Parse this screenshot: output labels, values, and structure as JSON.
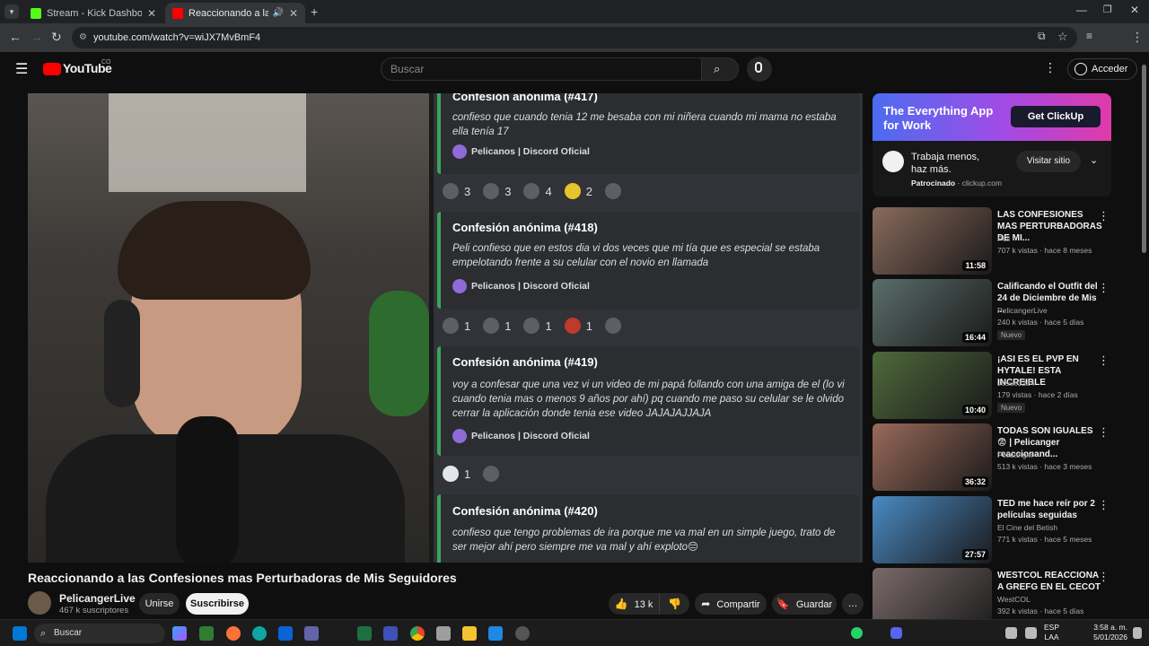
{
  "browser": {
    "tabs": [
      {
        "label": "Stream - Kick Dashboard",
        "color": "#53fc18"
      },
      {
        "label": "Reaccionando a las Confesi",
        "color": "#ff0000"
      }
    ],
    "url": "youtube.com/watch?v=wiJX7MvBmF4"
  },
  "youtube": {
    "logo": "YouTube",
    "country": "CO",
    "search_placeholder": "Buscar",
    "signin_label": "Acceder"
  },
  "video": {
    "chat": [
      {
        "title": "Confesión anónima (#417)",
        "body": "confieso que cuando tenia 12 me besaba con mi niñera cuando mi mama no estaba ella tenía 17",
        "source": "Pelicanos | Discord Oficial",
        "reactions": [
          "3",
          "3",
          "4",
          "2"
        ]
      },
      {
        "title": "Confesión anónima (#418)",
        "body": "Peli confieso que en estos dia vi dos veces que mi tía que es especial se estaba empelotando frente a su celular con el novio en llamada",
        "source": "Pelicanos | Discord Oficial",
        "reactions": [
          "1",
          "1",
          "1",
          "1"
        ]
      },
      {
        "title": "Confesión anónima (#419)",
        "body": "voy a confesar que una vez vi un video de mi papá follando con una amiga de el (lo vi cuando tenia mas o menos 9 años por ahí) pq cuando me paso su celular se le olvido cerrar la aplicación donde tenia ese video JAJAJAJJAJA",
        "source": "Pelicanos | Discord Oficial",
        "reactions": [
          "1"
        ]
      },
      {
        "title": "Confesión anónima (#420)",
        "body": "confieso que tengo problemas de ira porque me va mal en un simple juego, trato de ser mejor ahí pero siempre me va mal y ahí exploto😔",
        "source": "",
        "reactions": []
      }
    ],
    "title": "Reaccionando a las Confesiones mas Perturbadoras de Mis Seguidores",
    "channel": "PelicangerLive",
    "subscribers": "467 k suscriptores",
    "join_label": "Unirse",
    "subscribe_label": "Suscribirse",
    "likes": "13 k",
    "share_label": "Compartir",
    "save_label": "Guardar"
  },
  "ad": {
    "banner_text": "The Everything App for Work",
    "cta_banner": "Get ClickUp",
    "headline": "Trabaja menos, haz más.",
    "sponsored": "Patrocinado",
    "domain": "clickup.com",
    "visit_label": "Visitar sitio"
  },
  "recommendations": [
    {
      "title": "LAS CONFESIONES MAS PERTURBADORAS DE MI...",
      "channel": "Peli",
      "meta": "707 k vistas · hace 8 meses",
      "duration": "11:58",
      "nuevo": "",
      "thumb": "#8a6b5c"
    },
    {
      "title": "Calificando el Outfit del 24 de Diciembre de Mis ...",
      "channel": "PelicangerLive",
      "meta": "240 k vistas · hace 5 días",
      "duration": "16:44",
      "nuevo": "Nuevo",
      "thumb": "#5a6e6a"
    },
    {
      "title": "¡ASI ES EL PVP EN HYTALE! ESTA INCREIBLE",
      "channel": "Josue3234",
      "meta": "179 vistas · hace 2 días",
      "duration": "10:40",
      "nuevo": "Nuevo",
      "thumb": "#4e6a3a"
    },
    {
      "title": "TODAS SON IGUALES 😨 | Pelicanger reaccionand...",
      "channel": "Pelicanger",
      "meta": "513 k vistas · hace 3 meses",
      "duration": "36:32",
      "nuevo": "",
      "thumb": "#9a6a5a"
    },
    {
      "title": "TED me hace reír por 2 películas seguidas",
      "channel": "El Cine del Betish",
      "meta": "771 k vistas · hace 5 meses",
      "duration": "27:57",
      "nuevo": "",
      "thumb": "#4a8ac4"
    },
    {
      "title": "WESTCOL REACCIONA A GREFG EN EL CECOT",
      "channel": "WestCOL",
      "meta": "392 k vistas · hace 5 días",
      "duration": "",
      "nuevo": "",
      "thumb": "#7a6a6a"
    }
  ],
  "taskbar": {
    "search_label": "Buscar",
    "lang": "ESP",
    "lang_sub": "LAA",
    "time": "3:58 a. m.",
    "date": "5/01/2026"
  }
}
